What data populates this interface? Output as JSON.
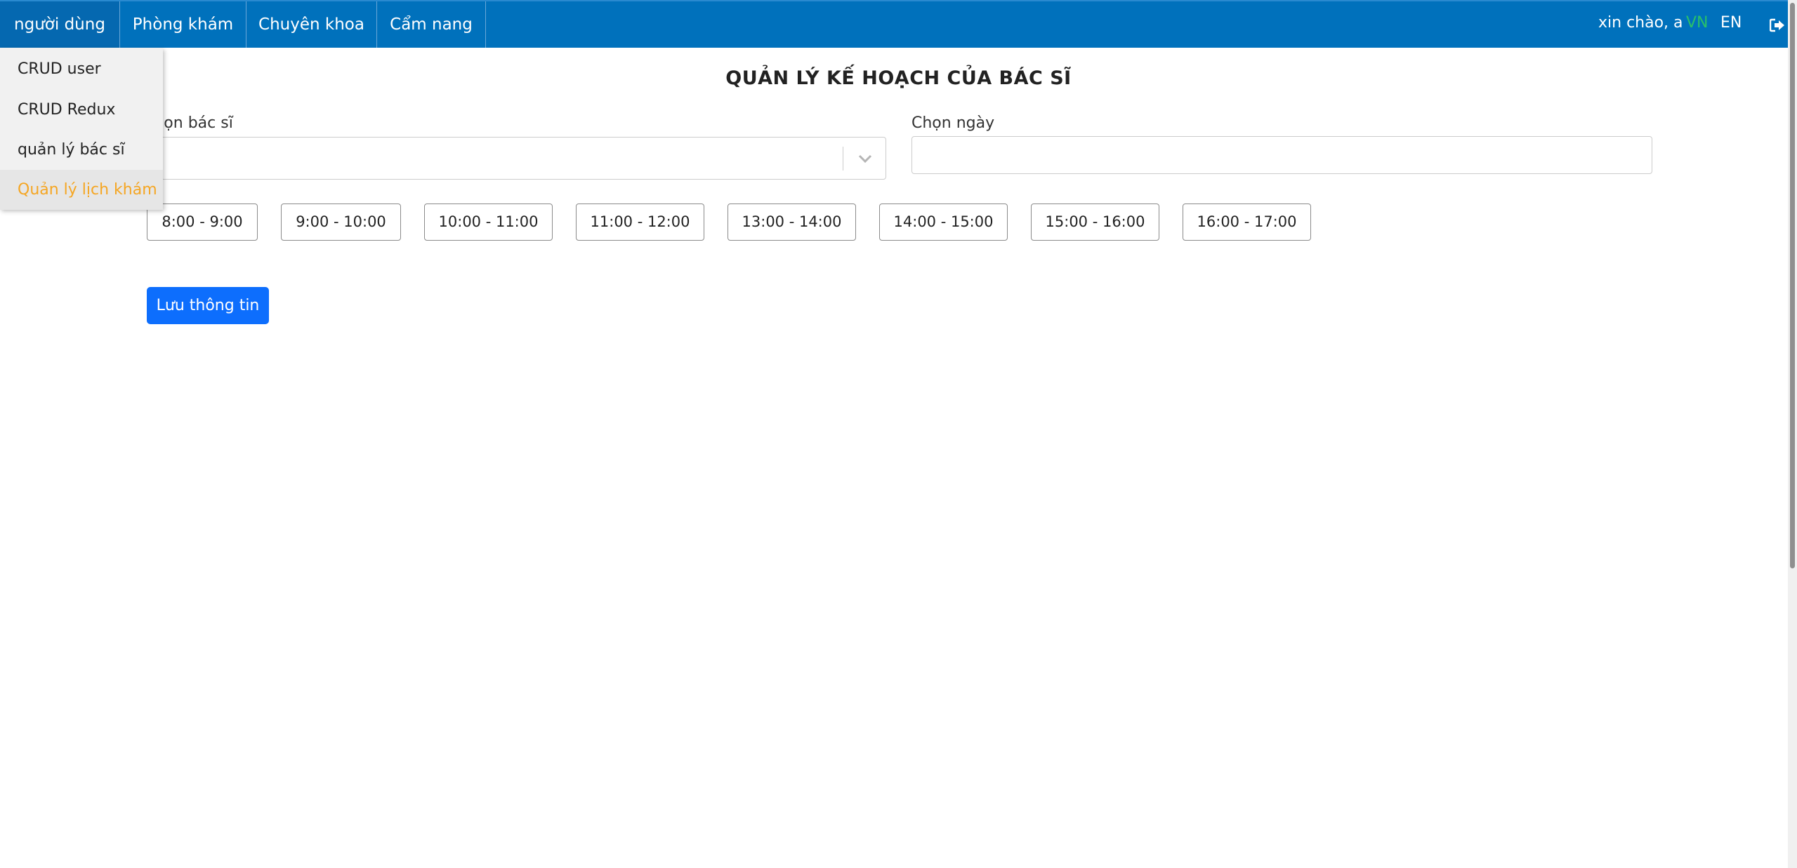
{
  "nav": {
    "items": [
      {
        "label": "người dùng"
      },
      {
        "label": "Phòng khám"
      },
      {
        "label": "Chuyên khoa"
      },
      {
        "label": "Cẩm nang"
      }
    ],
    "greeting": "xin chào, a",
    "lang_vn": "VN",
    "lang_en": "EN",
    "logout_icon": "sign-out-icon"
  },
  "dropdown": {
    "items": [
      {
        "label": "CRUD user"
      },
      {
        "label": "CRUD Redux"
      },
      {
        "label": "quản lý bác sĩ"
      },
      {
        "label": "Quản lý lịch khám",
        "active": true
      }
    ]
  },
  "main": {
    "title": "QUẢN LÝ KẾ HOẠCH CỦA BÁC SĨ",
    "doctor_label": "Chọn bác sĩ",
    "doctor_value": "",
    "date_label": "Chọn ngày",
    "date_value": "",
    "time_slots": [
      {
        "label": "8:00 - 9:00"
      },
      {
        "label": "9:00 - 10:00"
      },
      {
        "label": "10:00 - 11:00"
      },
      {
        "label": "11:00 - 12:00"
      },
      {
        "label": "13:00 - 14:00"
      },
      {
        "label": "14:00 - 15:00"
      },
      {
        "label": "15:00 - 16:00"
      },
      {
        "label": "16:00 - 17:00"
      }
    ],
    "save_label": "Lưu thông tin"
  },
  "colors": {
    "nav_bg": "#0071bc",
    "active_menu": "#f5a623",
    "lang_active": "#29c06a",
    "primary_button": "#0d6efd"
  }
}
